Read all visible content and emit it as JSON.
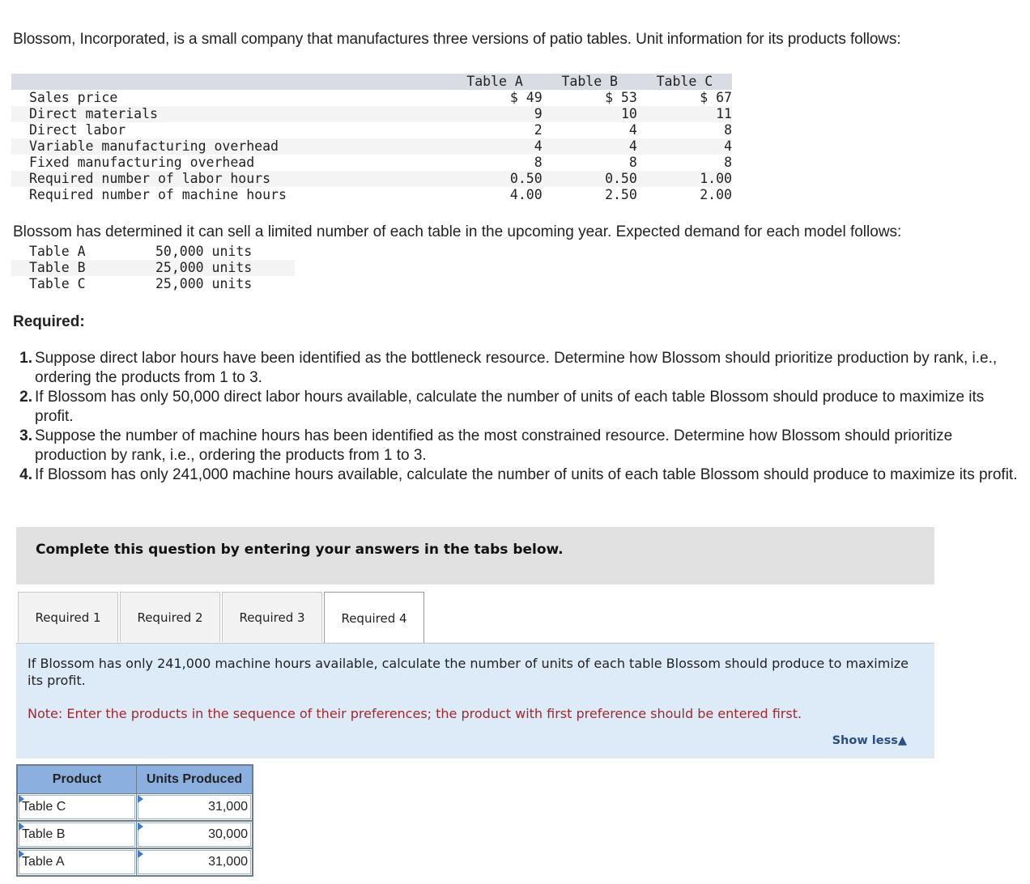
{
  "intro": "Blossom, Incorporated, is a small company that manufactures three versions of patio tables. Unit information for its products follows:",
  "unit_table": {
    "columns": [
      "Table A",
      "Table B",
      "Table C"
    ],
    "rows": [
      {
        "label": "Sales price",
        "values": [
          "$ 49",
          "$ 53",
          "$ 67"
        ]
      },
      {
        "label": "Direct materials",
        "values": [
          "9",
          "10",
          "11"
        ]
      },
      {
        "label": "Direct labor",
        "values": [
          "2",
          "4",
          "8"
        ]
      },
      {
        "label": "Variable manufacturing overhead",
        "values": [
          "4",
          "4",
          "4"
        ]
      },
      {
        "label": "Fixed manufacturing overhead",
        "values": [
          "8",
          "8",
          "8"
        ]
      },
      {
        "label": "Required number of labor hours",
        "values": [
          "0.50",
          "0.50",
          "1.00"
        ]
      },
      {
        "label": "Required number of machine hours",
        "values": [
          "4.00",
          "2.50",
          "2.00"
        ]
      }
    ]
  },
  "demand_intro": "Blossom has determined it can sell a limited number of each table in the upcoming year. Expected demand for each model follows:",
  "demand": [
    {
      "label": "Table A",
      "value": "50,000 units"
    },
    {
      "label": "Table B",
      "value": "25,000 units"
    },
    {
      "label": "Table C",
      "value": "25,000 units"
    }
  ],
  "required_title": "Required:",
  "required_items": [
    {
      "num": "1.",
      "text": "Suppose direct labor hours have been identified as the bottleneck resource. Determine how Blossom should prioritize production by rank, i.e., ordering the products from 1 to 3."
    },
    {
      "num": "2.",
      "text": "If Blossom has only 50,000 direct labor hours available, calculate the number of units of each table Blossom should produce to maximize its profit."
    },
    {
      "num": "3.",
      "text": "Suppose the number of machine hours has been identified as the most constrained resource. Determine how Blossom should prioritize production by rank, i.e., ordering the products from 1 to 3."
    },
    {
      "num": "4.",
      "text": "If Blossom has only 241,000 machine hours available, calculate the number of units of each table Blossom should produce to maximize its profit."
    }
  ],
  "instructions": "Complete this question by entering your answers in the tabs below.",
  "tabs": [
    {
      "label": "Required 1",
      "active": false
    },
    {
      "label": "Required 2",
      "active": false
    },
    {
      "label": "Required 3",
      "active": false
    },
    {
      "label": "Required 4",
      "active": true
    }
  ],
  "panel": {
    "question": "If Blossom has only 241,000 machine hours available, calculate the number of units of each table Blossom should produce to maximize its profit.",
    "note": "Note: Enter the products in the sequence of their preferences; the product with first preference should be entered first.",
    "show_less": "Show less",
    "show_less_icon": "triangle-up-icon"
  },
  "answer_table": {
    "headers": [
      "Product",
      "Units Produced"
    ],
    "rows": [
      {
        "product": "Table C",
        "units": "31,000"
      },
      {
        "product": "Table B",
        "units": "30,000"
      },
      {
        "product": "Table A",
        "units": "31,000"
      }
    ]
  }
}
